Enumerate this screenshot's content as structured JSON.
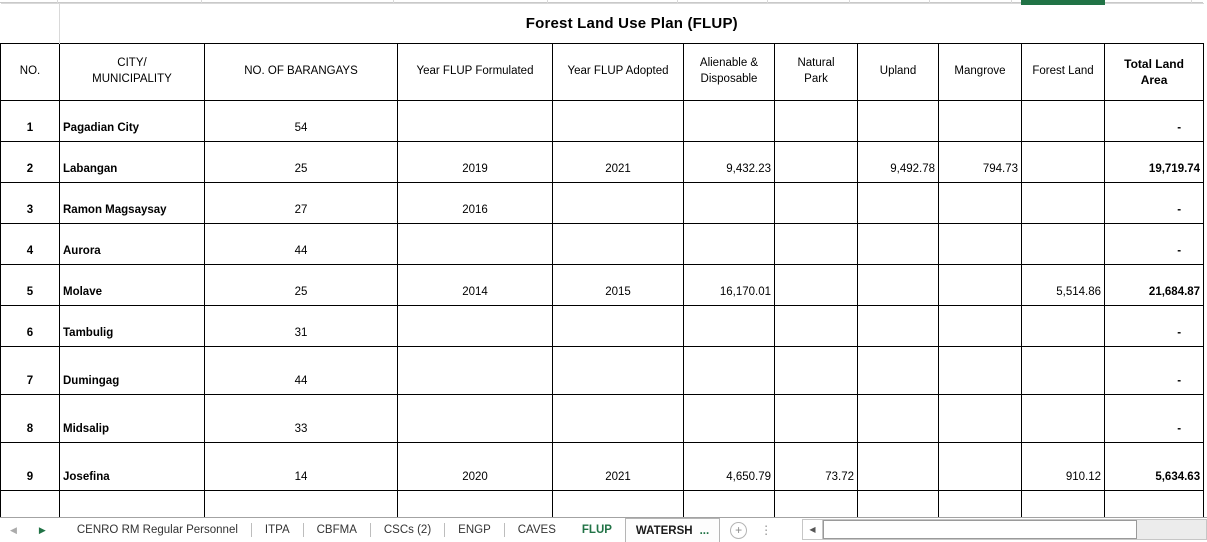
{
  "title": "Forest Land Use Plan (FLUP)",
  "table": {
    "columns": [
      "NO.",
      "CITY/\nMUNICIPALITY",
      "NO. OF BARANGAYS",
      "Year FLUP Formulated",
      "Year FLUP Adopted",
      "Alienable &\nDisposable",
      "Natural\nPark",
      "Upland",
      "Mangrove",
      "Forest Land",
      "Total Land\nArea"
    ],
    "rows": [
      [
        "1",
        "Pagadian City",
        "54",
        "",
        "",
        "",
        "",
        "",
        "",
        "",
        "-"
      ],
      [
        "2",
        "Labangan",
        "25",
        "2019",
        "2021",
        "9,432.23",
        "",
        "9,492.78",
        "794.73",
        "",
        "19,719.74"
      ],
      [
        "3",
        "Ramon Magsaysay",
        "27",
        "2016",
        "",
        "",
        "",
        "",
        "",
        "",
        "-"
      ],
      [
        "4",
        "Aurora",
        "44",
        "",
        "",
        "",
        "",
        "",
        "",
        "",
        "-"
      ],
      [
        "5",
        "Molave",
        "25",
        "2014",
        "2015",
        "16,170.01",
        "",
        "",
        "",
        "5,514.86",
        "21,684.87"
      ],
      [
        "6",
        "Tambulig",
        "31",
        "",
        "",
        "",
        "",
        "",
        "",
        "",
        "-"
      ],
      [
        "7",
        "Dumingag",
        "44",
        "",
        "",
        "",
        "",
        "",
        "",
        "",
        "-"
      ],
      [
        "8",
        "Midsalip",
        "33",
        "",
        "",
        "",
        "",
        "",
        "",
        "",
        "-"
      ],
      [
        "9",
        "Josefina",
        "14",
        "2020",
        "2021",
        "4,650.79",
        "73.72",
        "",
        "",
        "910.12",
        "5,634.63"
      ],
      [
        "",
        "",
        "",
        "",
        "",
        "",
        "",
        "",
        "",
        "",
        ""
      ]
    ]
  },
  "sheet_bar": {
    "nav_left": "◀",
    "nav_right": "▶",
    "tabs": [
      {
        "label": "CENRO RM Regular Personnel",
        "state": "normal"
      },
      {
        "label": "ITPA",
        "state": "normal"
      },
      {
        "label": "CBFMA",
        "state": "normal"
      },
      {
        "label": "CSCs (2)",
        "state": "normal"
      },
      {
        "label": "ENGP",
        "state": "normal"
      },
      {
        "label": "CAVES",
        "state": "normal"
      },
      {
        "label": "FLUP",
        "state": "active"
      },
      {
        "label": "WATERSH",
        "state": "boxed",
        "ellipsis": "..."
      }
    ],
    "new_sheet_label": "+",
    "tab_options_glyph": "⋮",
    "scroll_left_glyph": "◀"
  },
  "colors": {
    "accent_green": "#217346",
    "grid_black": "#000000",
    "gridline_gray": "#d9d9d9"
  }
}
